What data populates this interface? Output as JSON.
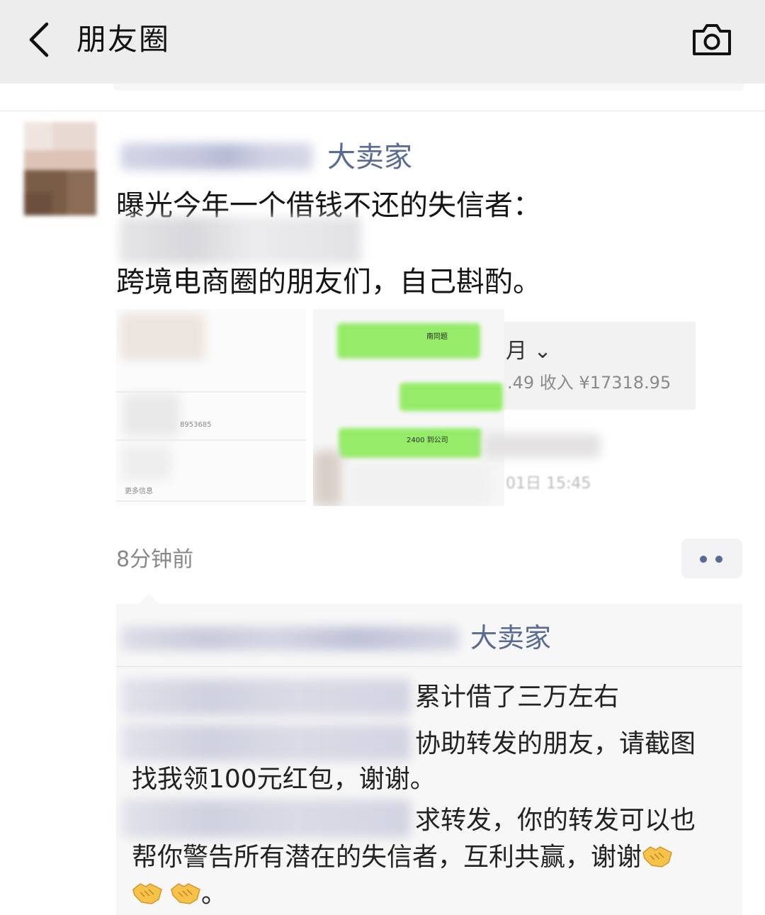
{
  "header": {
    "back_icon": "chevron-left-icon",
    "title": "朋友圈",
    "camera_icon": "camera-icon"
  },
  "post": {
    "author": "大卖家",
    "line1": "曝光今年一个借钱不还的失信者：",
    "line3": "跨境电商圈的朋友们，自己斟酌。",
    "time": "8分钟前",
    "more_icon": "more-dots-icon",
    "screenshot_right": {
      "month": "月 ⌄",
      "income": ".49  收入 ¥17318.95",
      "chat1": "南同题",
      "chat2": "2400 到公司",
      "time_ghost": "01日 15:45"
    },
    "screenshot_left": {
      "num": "8953685",
      "more": "更多信息"
    }
  },
  "comments": {
    "like_name": "大卖家",
    "c1": "累计借了三万左右",
    "c2_line1": "协助转发的朋友，请截图",
    "c2_line2": "找我领100元红包，谢谢。",
    "c3_line1": "求转发，你的转发可以也",
    "c3_line2": "帮你警告所有潜在的失信者，互利共赢，谢谢",
    "c3_tail": "。",
    "emoji_icon": "handshake-icon"
  },
  "colors": {
    "link": "#576b95",
    "topbar": "#ededed",
    "comment_bg": "#f7f7f7",
    "chat_green": "#95ec69"
  }
}
